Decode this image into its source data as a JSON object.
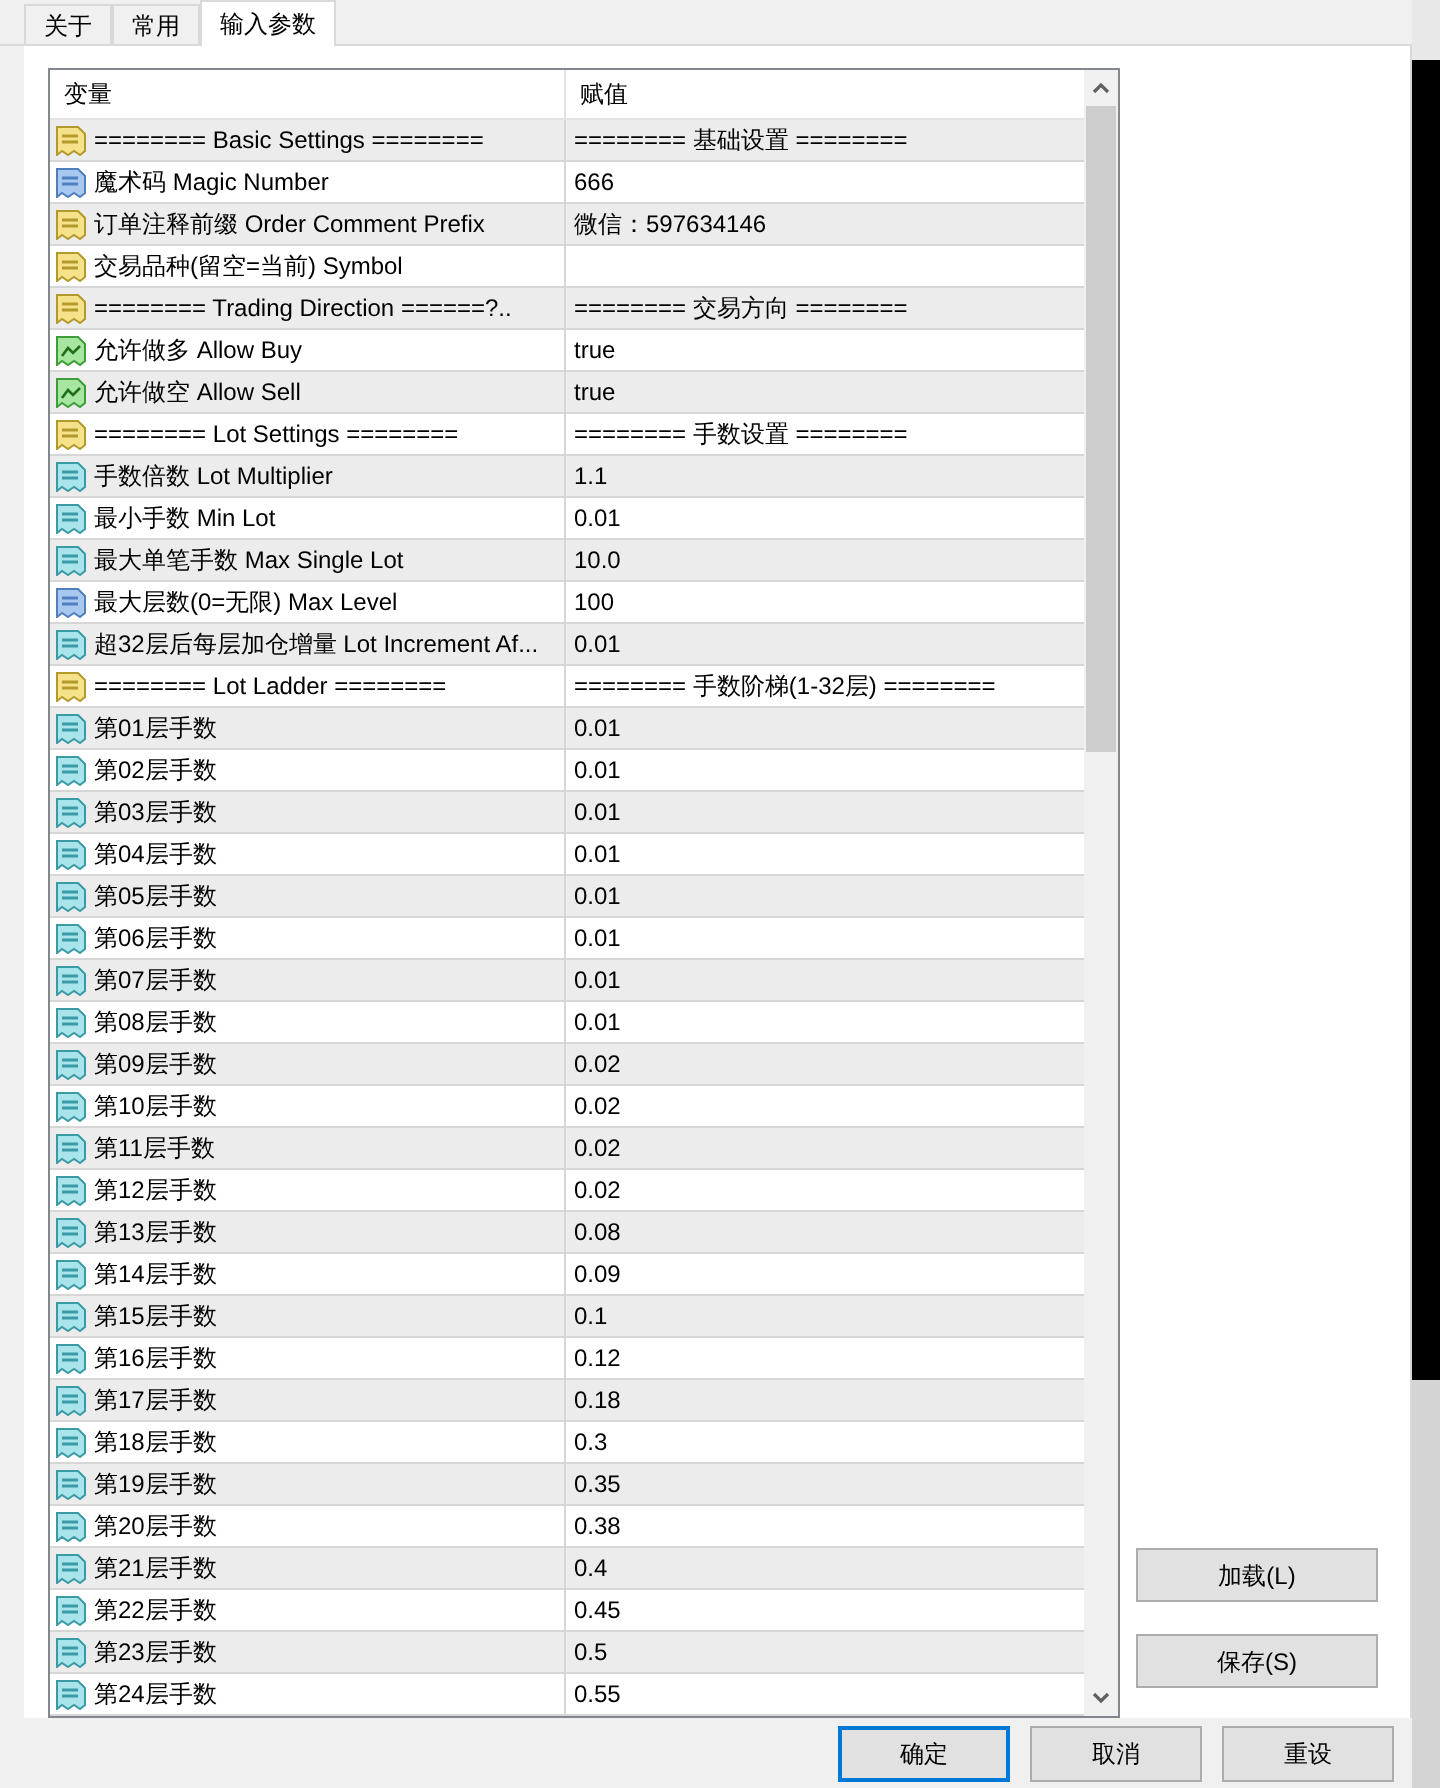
{
  "tabs": [
    {
      "label": "关于",
      "selected": false
    },
    {
      "label": "常用",
      "selected": false
    },
    {
      "label": "输入参数",
      "selected": true
    }
  ],
  "table": {
    "columns": [
      "变量",
      "赋值"
    ],
    "rows": [
      {
        "kind": "string",
        "name": "======== Basic Settings ========",
        "value": "======== 基础设置 ========"
      },
      {
        "kind": "int",
        "name": "魔术码 Magic Number",
        "value": "666"
      },
      {
        "kind": "string",
        "name": "订单注释前缀 Order Comment Prefix",
        "value": "微信：597634146"
      },
      {
        "kind": "string",
        "name": "交易品种(留空=当前) Symbol"
      },
      {
        "kind": "string",
        "name": "======== Trading Direction ======?..",
        "value": "======== 交易方向 ========"
      },
      {
        "kind": "bool",
        "name": "允许做多 Allow Buy",
        "value": "true"
      },
      {
        "kind": "bool",
        "name": "允许做空 Allow Sell",
        "value": "true"
      },
      {
        "kind": "string",
        "name": "======== Lot Settings ========",
        "value": "======== 手数设置 ========"
      },
      {
        "kind": "double",
        "name": "手数倍数 Lot Multiplier",
        "value": "1.1"
      },
      {
        "kind": "double",
        "name": "最小手数 Min Lot",
        "value": "0.01"
      },
      {
        "kind": "double",
        "name": "最大单笔手数 Max Single Lot",
        "value": "10.0"
      },
      {
        "kind": "int",
        "name": "最大层数(0=无限) Max Level",
        "value": "100"
      },
      {
        "kind": "double",
        "name": "超32层后每层加仓增量 Lot Increment Af...",
        "value": "0.01"
      },
      {
        "kind": "string",
        "name": "======== Lot Ladder ========",
        "value": "======== 手数阶梯(1-32层) ========"
      },
      {
        "kind": "double",
        "name": "第01层手数",
        "value": "0.01"
      },
      {
        "kind": "double",
        "name": "第02层手数",
        "value": "0.01"
      },
      {
        "kind": "double",
        "name": "第03层手数",
        "value": "0.01"
      },
      {
        "kind": "double",
        "name": "第04层手数",
        "value": "0.01"
      },
      {
        "kind": "double",
        "name": "第05层手数",
        "value": "0.01"
      },
      {
        "kind": "double",
        "name": "第06层手数",
        "value": "0.01"
      },
      {
        "kind": "double",
        "name": "第07层手数",
        "value": "0.01"
      },
      {
        "kind": "double",
        "name": "第08层手数",
        "value": "0.01"
      },
      {
        "kind": "double",
        "name": "第09层手数",
        "value": "0.02"
      },
      {
        "kind": "double",
        "name": "第10层手数",
        "value": "0.02"
      },
      {
        "kind": "double",
        "name": "第11层手数",
        "value": "0.02"
      },
      {
        "kind": "double",
        "name": "第12层手数",
        "value": "0.02"
      },
      {
        "kind": "double",
        "name": "第13层手数",
        "value": "0.08"
      },
      {
        "kind": "double",
        "name": "第14层手数",
        "value": "0.09"
      },
      {
        "kind": "double",
        "name": "第15层手数",
        "value": "0.1"
      },
      {
        "kind": "double",
        "name": "第16层手数",
        "value": "0.12"
      },
      {
        "kind": "double",
        "name": "第17层手数",
        "value": "0.18"
      },
      {
        "kind": "double",
        "name": "第18层手数",
        "value": "0.3"
      },
      {
        "kind": "double",
        "name": "第19层手数",
        "value": "0.35"
      },
      {
        "kind": "double",
        "name": "第20层手数",
        "value": "0.38"
      },
      {
        "kind": "double",
        "name": "第21层手数",
        "value": "0.4"
      },
      {
        "kind": "double",
        "name": "第22层手数",
        "value": "0.45"
      },
      {
        "kind": "double",
        "name": "第23层手数",
        "value": "0.5"
      },
      {
        "kind": "double",
        "name": "第24层手数",
        "value": "0.55"
      }
    ]
  },
  "side_buttons": [
    "加载(L)",
    "保存(S)"
  ],
  "buttons": [
    {
      "label": "确定",
      "focused": true
    },
    {
      "label": "取消",
      "focused": false
    },
    {
      "label": "重设",
      "focused": false
    }
  ]
}
